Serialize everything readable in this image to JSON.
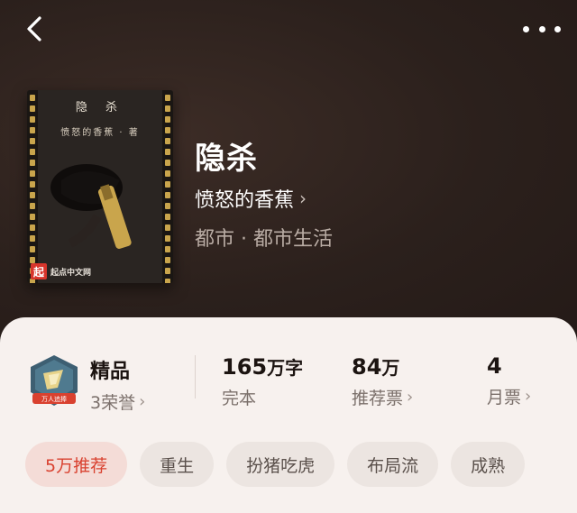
{
  "header": {
    "back_icon": "chevron-left-icon",
    "more_icon": "more-dots-icon"
  },
  "cover": {
    "title": "隐 杀",
    "author": "愤怒的香蕉 · 著",
    "brand_logo": "起",
    "brand_name": "起点中文网",
    "accent": "#c9a54c"
  },
  "book": {
    "title": "隐杀",
    "author": "愤怒的香蕉",
    "genre": "都市 · 都市生活"
  },
  "stats": {
    "honor": {
      "label": "精品",
      "sub": "3荣誉",
      "badge_text": "万人追捧"
    },
    "words": {
      "value": "165",
      "unit": "万字",
      "sub": "完本"
    },
    "recommend": {
      "value": "84",
      "unit": "万",
      "sub": "推荐票"
    },
    "monthly": {
      "value": "4",
      "sub": "月票"
    }
  },
  "tags": [
    {
      "label": "5万推荐",
      "highlight": true
    },
    {
      "label": "重生"
    },
    {
      "label": "扮猪吃虎"
    },
    {
      "label": "布局流"
    },
    {
      "label": "成熟"
    }
  ],
  "colors": {
    "accent_red": "#d9412f",
    "panel_bg": "#f7f1ee",
    "hero_bg": "#2b201c"
  }
}
